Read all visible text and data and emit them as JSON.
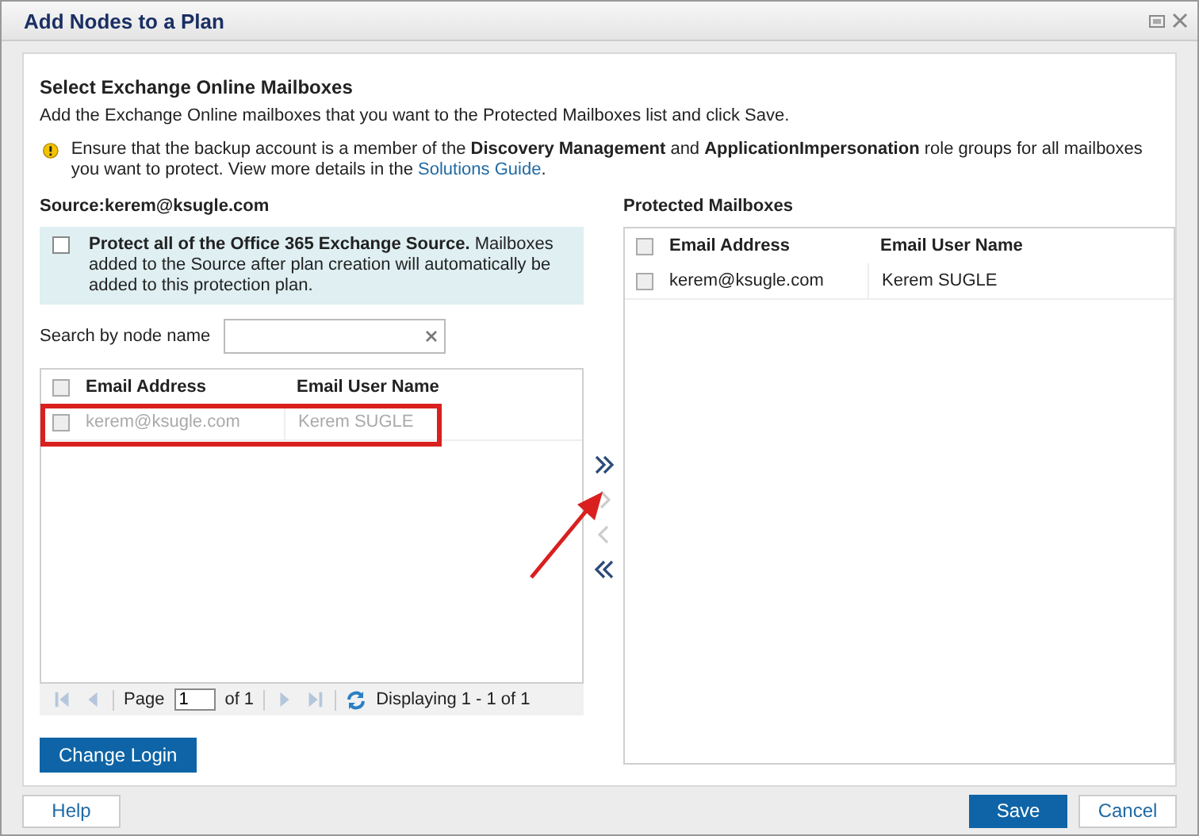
{
  "window": {
    "title": "Add Nodes to a Plan"
  },
  "heading": "Select Exchange Online Mailboxes",
  "description": "Add the Exchange Online mailboxes that you want to the Protected Mailboxes list and click Save.",
  "warning": {
    "text": "Ensure that the backup account is a member of the **Discovery Management** and **ApplicationImpersonation** role groups for all mailboxes you want to protect. View more details in the",
    "link": "Solutions Guide",
    "after": "."
  },
  "source": {
    "label": "Source:kerem@ksugle.com",
    "protect_all": {
      "checked": false,
      "title": "Protect all of the Office 365 Exchange Source.",
      "text": "Mailboxes added to the Source after plan creation will automatically be added to this protection plan."
    },
    "search": {
      "label": "Search by node name"
    },
    "columns": [
      "Email Address",
      "Email User Name"
    ],
    "header_checked": false,
    "rows": [
      {
        "email": "kerem@ksugle.com",
        "name": "Kerem SUGLE",
        "checked": false,
        "disabled": true
      }
    ],
    "pager": {
      "page_label": "Page",
      "page": "1",
      "of": "of 1",
      "display": "Displaying 1 - 1 of 1",
      "buttons": [
        {
          "kind": "first",
          "disabled": true
        },
        {
          "kind": "prev",
          "disabled": true
        },
        {
          "kind": "next",
          "disabled": true
        },
        {
          "kind": "last",
          "disabled": true
        }
      ]
    },
    "change_login": "Change Login"
  },
  "transfer": [
    {
      "kind": "add-all",
      "disabled": false
    },
    {
      "kind": "add",
      "disabled": true
    },
    {
      "kind": "remove",
      "disabled": true
    },
    {
      "kind": "remove-all",
      "disabled": false
    }
  ],
  "protected": {
    "label": "Protected Mailboxes",
    "columns": [
      "Email Address",
      "Email User Name"
    ],
    "header_checked": false,
    "rows": [
      {
        "email": "kerem@ksugle.com",
        "name": "Kerem SUGLE",
        "checked": false
      }
    ]
  },
  "footer": {
    "help": "Help",
    "save": "Save",
    "cancel": "Cancel"
  }
}
